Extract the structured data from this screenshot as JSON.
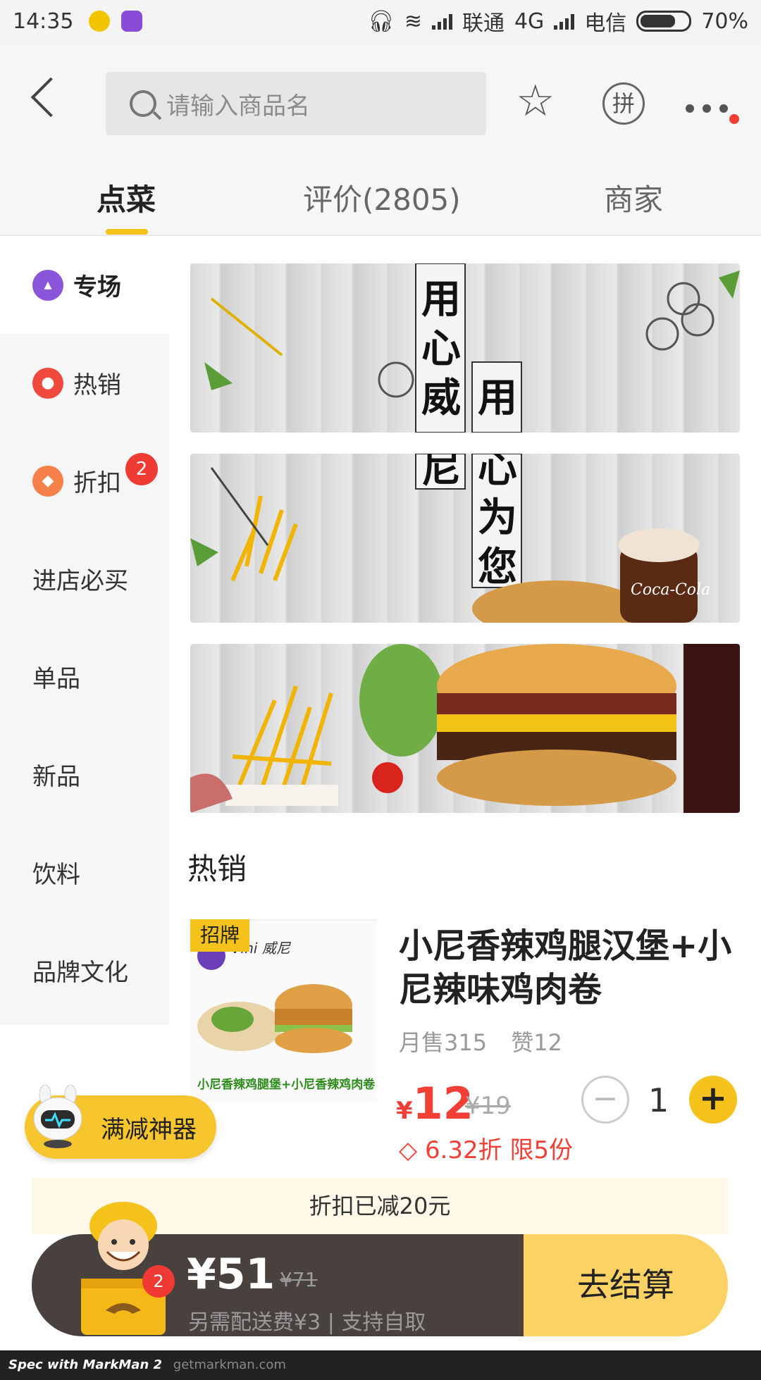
{
  "status_bar": {
    "time": "14:35",
    "carrier1": "联通",
    "network1": "4G",
    "carrier2": "电信",
    "battery": "70%"
  },
  "header": {
    "search_placeholder": "请输入商品名",
    "pin_label": "拼"
  },
  "tabs": [
    {
      "label": "点菜"
    },
    {
      "label": "评价(2805)"
    },
    {
      "label": "商家"
    }
  ],
  "sidebar": {
    "items": [
      {
        "label": "专场",
        "icon": "bag-icon"
      },
      {
        "label": "热销",
        "icon": "flame-icon"
      },
      {
        "label": "折扣",
        "icon": "tag-icon",
        "badge": "2"
      },
      {
        "label": "进店必买"
      },
      {
        "label": "单品"
      },
      {
        "label": "新品"
      },
      {
        "label": "饮料"
      },
      {
        "label": "品牌文化"
      }
    ]
  },
  "banner": {
    "slogan1": "用心威尼",
    "slogan2": "用心为您"
  },
  "section": {
    "title": "热销"
  },
  "product": {
    "tag": "招牌",
    "name": "小尼香辣鸡腿汉堡+小尼辣味鸡肉卷",
    "monthly_sales": "月售315",
    "likes": "赞12",
    "price_currency": "¥",
    "price": "12",
    "original_price": "¥19",
    "quantity": "1",
    "discount_info": "6.32折 限5份",
    "image_caption": "小尼香辣鸡腿堡+小尼香辣鸡肉卷",
    "brand": "Vini 威尼"
  },
  "floating": {
    "manjian_label": "满减神器"
  },
  "cart": {
    "discount_strip": "折扣已减20元",
    "total": "¥51",
    "original_total": "¥71",
    "delivery_note": "另需配送费¥3 | 支持自取",
    "checkout_label": "去结算",
    "badge": "2"
  },
  "footer": {
    "spec_text": "Spec with MarkMan 2",
    "spec_url": "getmarkman.com"
  },
  "colors": {
    "accent": "#f5c21c",
    "price_red": "#f23f36",
    "cart_dark": "#48413e",
    "checkout": "#fdd264",
    "strip_bg": "#fff7e7",
    "muted": "#9a9a9a"
  }
}
